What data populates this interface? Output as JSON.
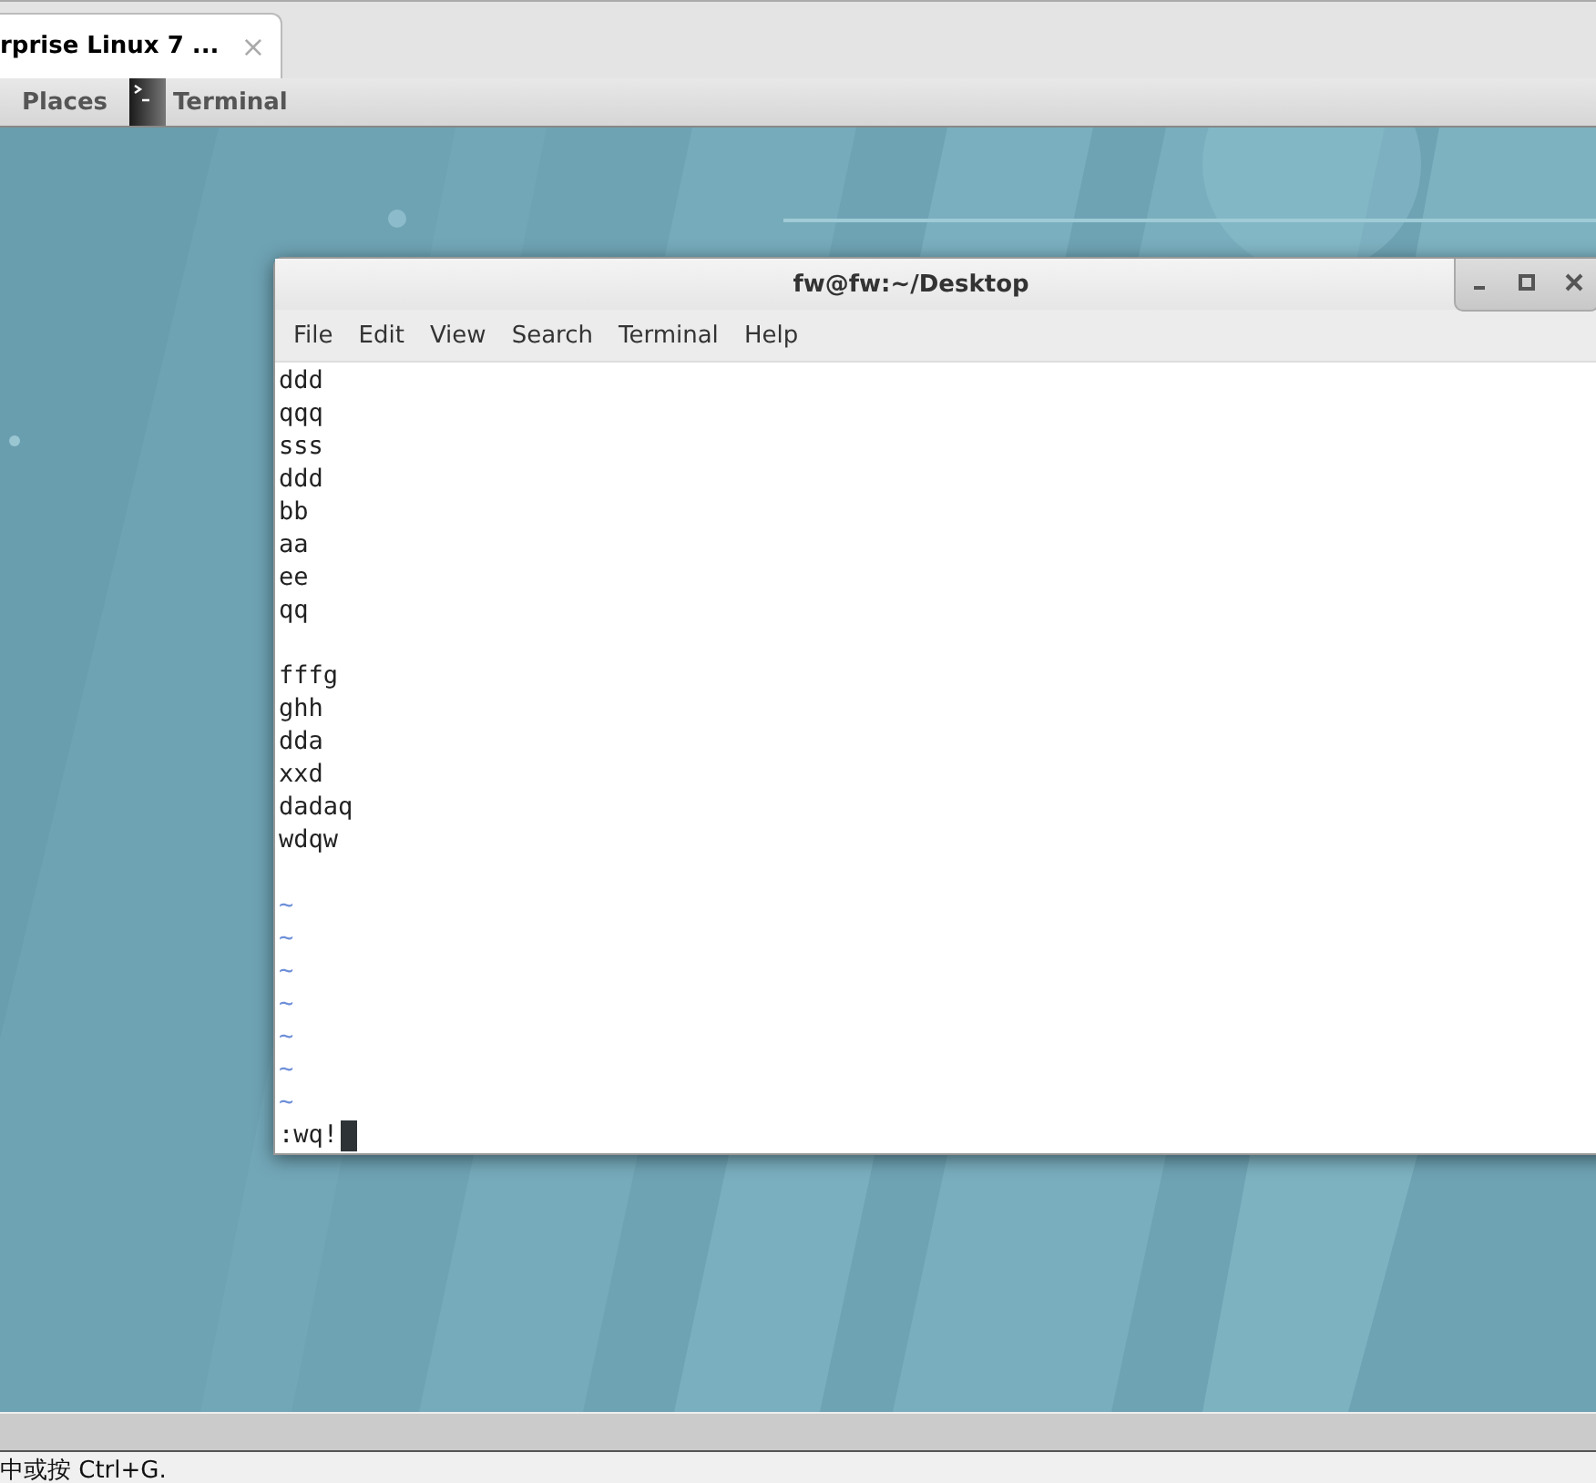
{
  "browser_tab": {
    "title": "rprise Linux 7 ...",
    "close": "×",
    "selected": true
  },
  "taskbar": {
    "items": [
      {
        "kind": "menu",
        "label": "Places"
      },
      {
        "kind": "window",
        "label": "Terminal"
      }
    ]
  },
  "terminal": {
    "title": "fw@fw:~/Desktop",
    "menu": [
      "File",
      "Edit",
      "View",
      "Search",
      "Terminal",
      "Help"
    ],
    "lines": [
      {
        "kind": "text",
        "text": "ddd"
      },
      {
        "kind": "text",
        "text": "qqq"
      },
      {
        "kind": "text",
        "text": "sss"
      },
      {
        "kind": "text",
        "text": "ddd"
      },
      {
        "kind": "text",
        "text": "bb"
      },
      {
        "kind": "text",
        "text": "aa"
      },
      {
        "kind": "text",
        "text": "ee"
      },
      {
        "kind": "text",
        "text": "qq"
      },
      {
        "kind": "blank"
      },
      {
        "kind": "text",
        "text": "fffg"
      },
      {
        "kind": "text",
        "text": "ghh"
      },
      {
        "kind": "text",
        "text": "dda"
      },
      {
        "kind": "text",
        "text": "xxd"
      },
      {
        "kind": "text",
        "text": "dadaq"
      },
      {
        "kind": "text",
        "text": "wdqw"
      },
      {
        "kind": "blank"
      },
      {
        "kind": "tilde",
        "text": "~"
      },
      {
        "kind": "tilde",
        "text": "~"
      },
      {
        "kind": "tilde",
        "text": "~"
      },
      {
        "kind": "tilde",
        "text": "~"
      },
      {
        "kind": "tilde",
        "text": "~"
      },
      {
        "kind": "tilde",
        "text": "~"
      },
      {
        "kind": "tilde",
        "text": "~"
      },
      {
        "kind": "command",
        "text": ":wq!"
      }
    ]
  },
  "status_bar": {
    "text": "中或按 Ctrl+G."
  }
}
